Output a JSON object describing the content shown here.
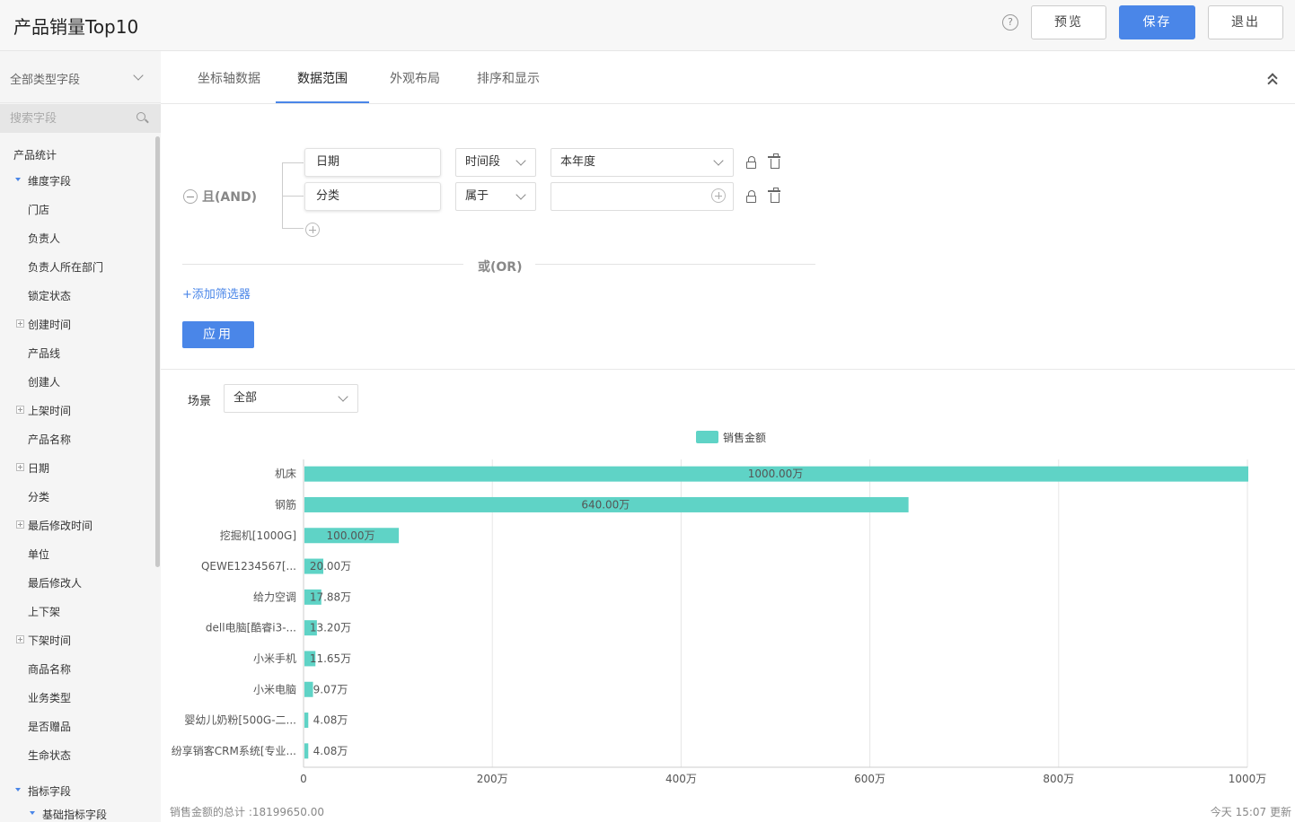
{
  "header": {
    "title": "产品销量Top10",
    "help_icon": "?",
    "preview_label": "预览",
    "save_label": "保存",
    "exit_label": "退出"
  },
  "sidebar": {
    "field_type": "全部类型字段",
    "search_placeholder": "搜索字段",
    "group": "产品统计",
    "dimension_section": "维度字段",
    "dimension_items": [
      {
        "label": "门店",
        "expandable": false
      },
      {
        "label": "负责人",
        "expandable": false
      },
      {
        "label": "负责人所在部门",
        "expandable": false
      },
      {
        "label": "锁定状态",
        "expandable": false
      },
      {
        "label": "创建时间",
        "expandable": true
      },
      {
        "label": "产品线",
        "expandable": false
      },
      {
        "label": "创建人",
        "expandable": false
      },
      {
        "label": "上架时间",
        "expandable": true
      },
      {
        "label": "产品名称",
        "expandable": false
      },
      {
        "label": "日期",
        "expandable": true
      },
      {
        "label": "分类",
        "expandable": false
      },
      {
        "label": "最后修改时间",
        "expandable": true
      },
      {
        "label": "单位",
        "expandable": false
      },
      {
        "label": "最后修改人",
        "expandable": false
      },
      {
        "label": "上下架",
        "expandable": false
      },
      {
        "label": "下架时间",
        "expandable": true
      },
      {
        "label": "商品名称",
        "expandable": false
      },
      {
        "label": "业务类型",
        "expandable": false
      },
      {
        "label": "是否赠品",
        "expandable": false
      },
      {
        "label": "生命状态",
        "expandable": false
      }
    ],
    "metric_section": "指标字段",
    "metric_sub": "基础指标字段"
  },
  "tabs": [
    {
      "label": "坐标轴数据",
      "active": false
    },
    {
      "label": "数据范围",
      "active": true
    },
    {
      "label": "外观布局",
      "active": false
    },
    {
      "label": "排序和显示",
      "active": false
    }
  ],
  "filter": {
    "and_label": "且(AND)",
    "or_label": "或(OR)",
    "rows": [
      {
        "field": "日期",
        "operator": "时间段",
        "value": "本年度"
      },
      {
        "field": "分类",
        "operator": "属于",
        "value": ""
      }
    ],
    "add_filter_label": "+添加筛选器",
    "apply_label": "应用"
  },
  "scene": {
    "label": "场景",
    "value": "全部"
  },
  "chart_data": {
    "type": "bar",
    "orientation": "horizontal",
    "legend": "销售金额",
    "series_color": "#5fd3c6",
    "categories": [
      "机床",
      "钢筋",
      "挖掘机[1000G]",
      "QEWE1234567[...",
      "给力空调",
      "dell电脑[酷睿i3-...",
      "小米手机",
      "小米电脑",
      "婴幼儿奶粉[500G-二...",
      "纷享销客CRM系统[专业..."
    ],
    "values": [
      10000000,
      6400000,
      1000000,
      200000,
      178800,
      132000,
      116500,
      90700,
      40800,
      40800
    ],
    "data_labels": [
      "1000.00万",
      "640.00万",
      "100.00万",
      "20.00万",
      "17.88万",
      "13.20万",
      "11.65万",
      "9.07万",
      "4.08万",
      "4.08万"
    ],
    "x_ticks": [
      0,
      2000000,
      4000000,
      6000000,
      8000000,
      10000000
    ],
    "x_tick_labels": [
      "0",
      "200万",
      "400万",
      "600万",
      "800万",
      "1000万"
    ],
    "xlim": [
      0,
      10000000
    ],
    "grid": true
  },
  "footer": {
    "total": "销售金额的总计 :18199650.00",
    "updated": "今天 15:07 更新"
  }
}
